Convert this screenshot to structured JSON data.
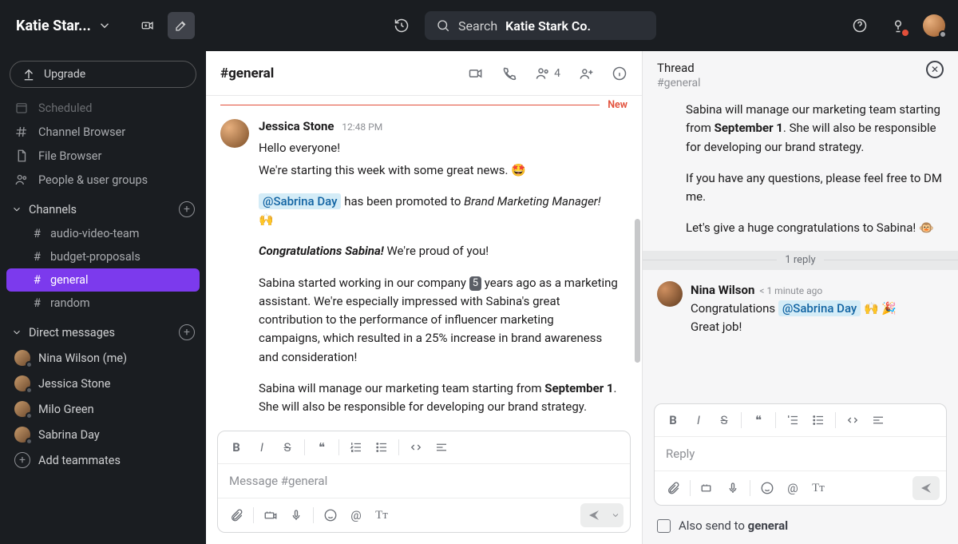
{
  "workspace": {
    "name": "Katie Star..."
  },
  "search": {
    "prefix": "Search",
    "workspace": "Katie Stark Co."
  },
  "sidebar": {
    "upgrade": "Upgrade",
    "nav": [
      {
        "label": "Scheduled",
        "icon": "scheduled"
      },
      {
        "label": "Channel Browser",
        "icon": "channel-browser"
      },
      {
        "label": "File Browser",
        "icon": "file-browser"
      },
      {
        "label": "People & user groups",
        "icon": "people"
      }
    ],
    "channels_header": "Channels",
    "channels": [
      {
        "name": "audio-video-team",
        "active": false
      },
      {
        "name": "budget-proposals",
        "active": false
      },
      {
        "name": "general",
        "active": true
      },
      {
        "name": "random",
        "active": false
      }
    ],
    "dm_header": "Direct messages",
    "dms": [
      {
        "name": "Nina Wilson (me)"
      },
      {
        "name": "Jessica Stone"
      },
      {
        "name": "Milo Green"
      },
      {
        "name": "Sabrina Day"
      }
    ],
    "add_teammates": "Add teammates"
  },
  "channel": {
    "title": "#general",
    "members": "4",
    "new_label": "New",
    "message": {
      "author": "Jessica Stone",
      "time": "12:48 PM",
      "line1": "Hello everyone!",
      "line2": "We're starting this week with some great news. 🤩",
      "mention": "@Sabrina Day",
      "promo_text": " has been promoted to ",
      "promo_role": "Brand Marketing Manager!",
      "hands": "🙌",
      "congrats_bold": "Congratulations Sabina!",
      "congrats_rest": " We're proud of you!",
      "para_start": "Sabina started working in our company ",
      "years_box": "5",
      "para_after_box": " years ago as a marketing assistant. We're especially impressed with Sabina's great contribution to the performance of influencer marketing campaigns, which resulted in a 25% increase in brand awareness and consideration!",
      "manage_pre": "Sabina will manage our marketing team starting from ",
      "manage_date": "September 1",
      "manage_post": ". She will also be responsible for developing our brand strategy."
    },
    "composer": {
      "placeholder": "Message #general"
    }
  },
  "thread": {
    "title": "Thread",
    "subtitle": "#general",
    "body": {
      "p1_pre": "Sabina will manage our marketing team starting from ",
      "p1_date": "September 1",
      "p1_post": ". She will also be responsible for developing our brand strategy.",
      "p2": "If you have any questions, please feel free to DM me.",
      "p3": "Let's give a huge congratulations to Sabina! 🐵"
    },
    "reply_count": "1 reply",
    "reply": {
      "author": "Nina Wilson",
      "time": "< 1 minute ago",
      "line1_pre": "Congratulations ",
      "mention": "@Sabrina Day",
      "line1_post": " 🙌 🎉",
      "line2": "Great job!"
    },
    "composer": {
      "placeholder": "Reply"
    },
    "also_send_pre": "Also send to ",
    "also_send_chan": "general"
  }
}
